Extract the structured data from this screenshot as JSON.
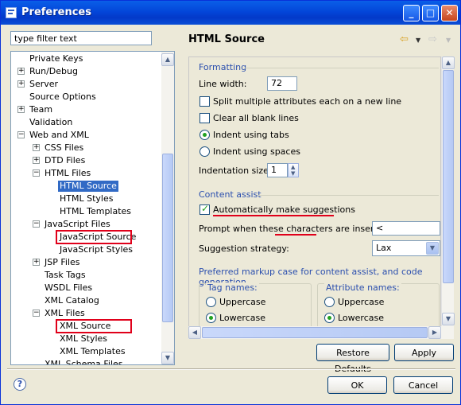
{
  "window": {
    "title": "Preferences"
  },
  "filter": {
    "placeholder": "type filter text",
    "value": "type filter text"
  },
  "tree": {
    "items": [
      {
        "label": "Private Keys",
        "indent": 0,
        "expander": ""
      },
      {
        "label": "Run/Debug",
        "indent": 0,
        "expander": "+"
      },
      {
        "label": "Server",
        "indent": 0,
        "expander": "+"
      },
      {
        "label": "Source Options",
        "indent": 0,
        "expander": ""
      },
      {
        "label": "Team",
        "indent": 0,
        "expander": "+"
      },
      {
        "label": "Validation",
        "indent": 0,
        "expander": ""
      },
      {
        "label": "Web and XML",
        "indent": 0,
        "expander": "−"
      },
      {
        "label": "CSS Files",
        "indent": 1,
        "expander": "+"
      },
      {
        "label": "DTD Files",
        "indent": 1,
        "expander": "+"
      },
      {
        "label": "HTML Files",
        "indent": 1,
        "expander": "−"
      },
      {
        "label": "HTML Source",
        "indent": 2,
        "expander": "",
        "selected": true
      },
      {
        "label": "HTML Styles",
        "indent": 2,
        "expander": ""
      },
      {
        "label": "HTML Templates",
        "indent": 2,
        "expander": ""
      },
      {
        "label": "JavaScript Files",
        "indent": 1,
        "expander": "−"
      },
      {
        "label": "JavaScript Source",
        "indent": 2,
        "expander": "",
        "boxed": true
      },
      {
        "label": "JavaScript Styles",
        "indent": 2,
        "expander": ""
      },
      {
        "label": "JSP Files",
        "indent": 1,
        "expander": "+"
      },
      {
        "label": "Task Tags",
        "indent": 1,
        "expander": ""
      },
      {
        "label": "WSDL Files",
        "indent": 1,
        "expander": ""
      },
      {
        "label": "XML Catalog",
        "indent": 1,
        "expander": ""
      },
      {
        "label": "XML Files",
        "indent": 1,
        "expander": "−"
      },
      {
        "label": "XML Source",
        "indent": 2,
        "expander": "",
        "boxed": true
      },
      {
        "label": "XML Styles",
        "indent": 2,
        "expander": ""
      },
      {
        "label": "XML Templates",
        "indent": 2,
        "expander": ""
      },
      {
        "label": "XML Schema Files",
        "indent": 1,
        "expander": ""
      }
    ]
  },
  "page": {
    "title": "HTML Source",
    "formatting": {
      "title": "Formatting",
      "line_width_label": "Line width:",
      "line_width_value": "72",
      "split_attrs_label": "Split multiple attributes each on a new line",
      "clear_blank_label": "Clear all blank lines",
      "indent_tabs_label": "Indent using tabs",
      "indent_spaces_label": "Indent using spaces",
      "indent_size_label": "Indentation size:",
      "indent_size_value": "1"
    },
    "content_assist": {
      "title": "Content assist",
      "auto_suggest_label": "Automatically make suggestions",
      "prompt_label": "Prompt when these characters are inserted:",
      "prompt_value": "<",
      "strategy_label": "Suggestion strategy:",
      "strategy_value": "Lax"
    },
    "markup_case": {
      "title": "Preferred markup case for content assist, and code generation",
      "tag_names_title": "Tag names:",
      "attr_names_title": "Attribute names:",
      "uppercase_label": "Uppercase",
      "lowercase_label": "Lowercase"
    }
  },
  "buttons": {
    "restore_defaults": "Restore Defaults",
    "apply": "Apply",
    "ok": "OK",
    "cancel": "Cancel"
  },
  "colors": {
    "accent": "#316ac5",
    "highlight": "#e0001a",
    "group_title": "#2b4fae"
  }
}
